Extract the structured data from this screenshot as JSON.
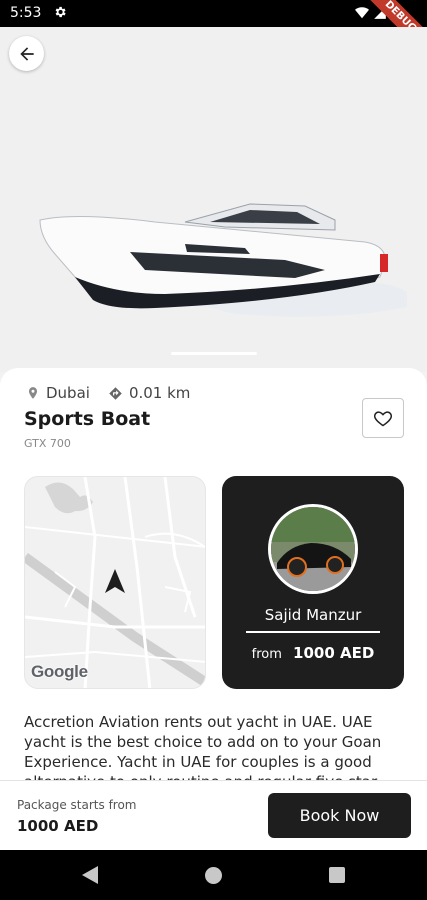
{
  "status": {
    "time": "5:53",
    "debug_label": "DEBUG"
  },
  "hero": {
    "image_alt": "Sports boat photo"
  },
  "listing": {
    "location": "Dubai",
    "distance": "0.01 km",
    "title": "Sports Boat",
    "subtitle": "GTX 700"
  },
  "map": {
    "logo_text": "Google"
  },
  "host": {
    "name": "Sajid Manzur",
    "price_prefix": "from",
    "price": "1000 AED"
  },
  "description": "Accretion Aviation rents out yacht in UAE. UAE yacht is the best choice to add on to your Goan Experience. Yacht in UAE for couples is a good alternative to only routine and regular five star",
  "footer": {
    "package_label": "Package starts from",
    "package_price": "1000 AED",
    "book_label": "Book Now"
  },
  "colors": {
    "dark": "#1e1e1e",
    "accent_ribbon": "#c0392b"
  }
}
